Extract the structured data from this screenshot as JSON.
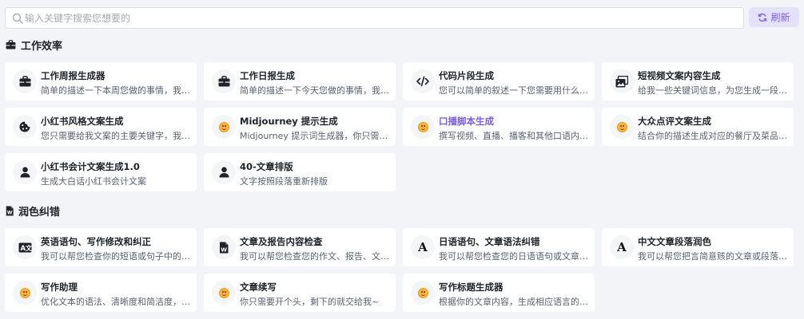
{
  "search": {
    "placeholder": "输入关键字搜索您想要的"
  },
  "refresh_label": "刷新",
  "sections": [
    {
      "title": "工作效率",
      "icon": "briefcase-icon",
      "cards": [
        {
          "title": "工作周报生成器",
          "desc": "简单的描述一下本周您做的事情，我帮...",
          "icon": "briefcase-icon"
        },
        {
          "title": "工作日报生成",
          "desc": "简单的描述一下今天您做的事情，我帮...",
          "icon": "briefcase-icon"
        },
        {
          "title": "代码片段生成",
          "desc": "您可以简单的叙述一下您需要用什么开...",
          "icon": "code-icon"
        },
        {
          "title": "短视频文案内容生成",
          "desc": "给我一些关键词信息，为您生成一段短...",
          "icon": "photo-gallery-icon"
        },
        {
          "title": "小红书风格文案生成",
          "desc": "您只需要给我文案的主要关键字，我就...",
          "icon": "cookie-icon"
        },
        {
          "title": "Midjourney 提示生成",
          "desc": "Midjourney 提示词生成器，你只需要...",
          "icon": "smiley-icon"
        },
        {
          "title": "口播脚本生成",
          "desc": "撰写视频、直播、播客和其他口语内容...",
          "icon": "smiley-icon",
          "highlight": true
        },
        {
          "title": "大众点评文案生成",
          "desc": "结合你的描述生成对应的餐厅及菜品评论",
          "icon": "smiley-icon"
        },
        {
          "title": "小红书会计文案生成1.0",
          "desc": "生成大白话小红书会计文案",
          "icon": "user-icon"
        },
        {
          "title": "40-文章排版",
          "desc": "文字按照段落重新排版",
          "icon": "user-icon"
        }
      ]
    },
    {
      "title": "润色纠错",
      "icon": "word-file-icon",
      "cards": [
        {
          "title": "英语语句、写作修改和纠正",
          "desc": "我可以帮您检查你的短语或句子中的语...",
          "icon": "language-icon"
        },
        {
          "title": "文章及报告内容检查",
          "desc": "我可以帮您检查您的作文、报告、文案...",
          "icon": "word-file-icon"
        },
        {
          "title": "日语语句、文章语法纠错",
          "desc": "我可以帮您检查您的日语语句或文章中...",
          "icon": "letter-a-icon"
        },
        {
          "title": "中文文章段落润色",
          "desc": "我可以帮您把言简意赅的文章或段落改...",
          "icon": "letter-a-icon"
        },
        {
          "title": "写作助理",
          "desc": "优化文本的语法、清晰度和简洁度，提...",
          "icon": "smiley-icon"
        },
        {
          "title": "文章续写",
          "desc": "你只需要开个头，剩下的就交给我~",
          "icon": "smiley-icon"
        },
        {
          "title": "写作标题生成器",
          "desc": "根据你的文章内容，生成相应语言的标题",
          "icon": "smiley-icon"
        }
      ]
    }
  ]
}
